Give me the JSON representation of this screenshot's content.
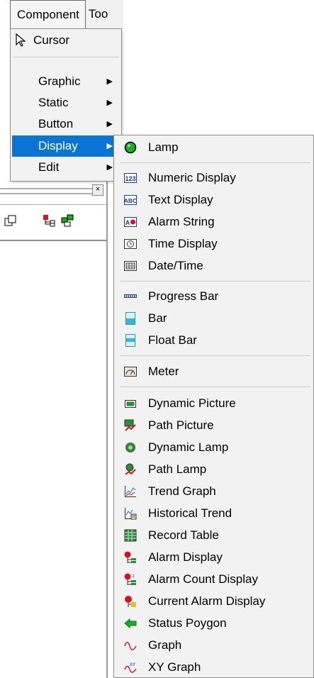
{
  "menubar": {
    "component": "Component",
    "tools": "Too"
  },
  "component_menu": {
    "cursor": "Cursor",
    "items": [
      {
        "label": "Graphic"
      },
      {
        "label": "Static"
      },
      {
        "label": "Button"
      },
      {
        "label": "Display"
      },
      {
        "label": "Edit"
      }
    ],
    "selected": "Display"
  },
  "display_menu": {
    "lamp": "Lamp",
    "group_text": [
      "Numeric Display",
      "Text Display",
      "Alarm String",
      "Time Display",
      "Date/Time"
    ],
    "group_bar": [
      "Progress Bar",
      "Bar",
      "Float Bar"
    ],
    "meter": "Meter",
    "group_graph": [
      "Dynamic Picture",
      "Path Picture",
      "Dynamic Lamp",
      "Path Lamp",
      "Trend Graph",
      "Historical Trend",
      "Record Table",
      "Alarm Display",
      "Alarm Count Display",
      "Current Alarm Display",
      "Status Poygon",
      "Graph",
      "XY Graph"
    ]
  },
  "icons": {
    "lamp": "green-circle-icon",
    "numeric_display": "123-icon",
    "text_display": "abc-icon",
    "alarm_string": "a-bell-icon",
    "time_display": "clock-icon",
    "date_time": "calendar-icon"
  },
  "colors": {
    "selection": "#0a74d4",
    "menu_bg": "#f2f2f2"
  }
}
